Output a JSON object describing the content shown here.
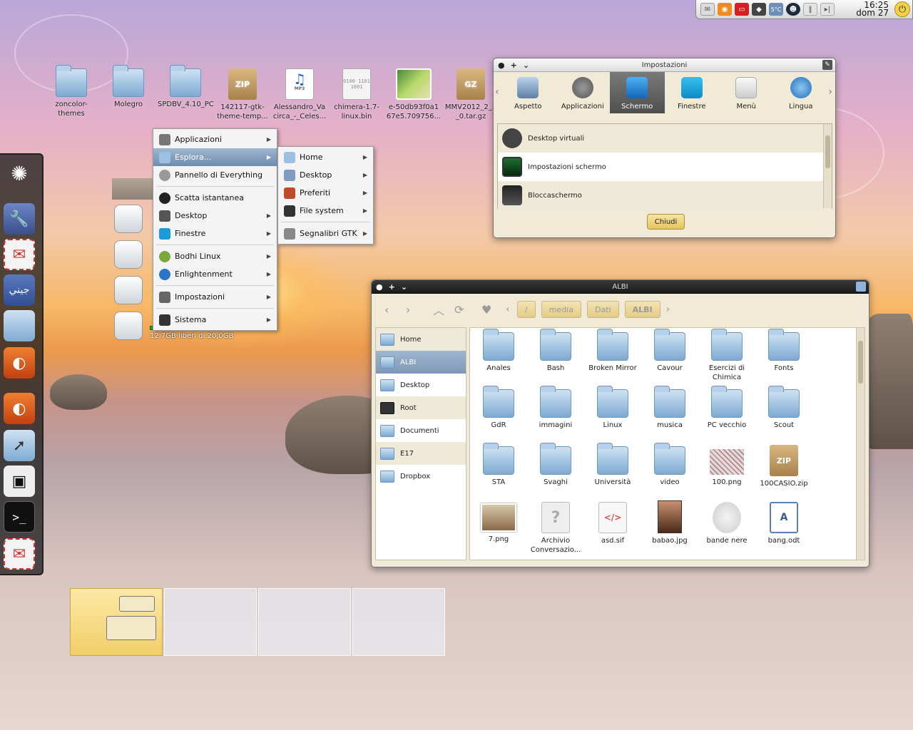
{
  "topbar": {
    "clock_time": "16:25",
    "clock_date": "dom 27",
    "weather": "5°C",
    "tray_icons": [
      "mail-icon",
      "rss-icon",
      "battery-icon",
      "dropbox-icon",
      "weather-icon",
      "alien-icon",
      "pause-icon",
      "next-icon",
      "power-icon"
    ]
  },
  "desktop_icons": [
    {
      "label": "zoncolor-themes",
      "type": "folder"
    },
    {
      "label": "Molegro",
      "type": "folder"
    },
    {
      "label": "SPDBV_4.10_PC",
      "type": "folder"
    },
    {
      "label": "142117-gtk-theme-temp...",
      "type": "zip",
      "badge": "ZIP"
    },
    {
      "label": "Alessandro_Va circa_-_Celes...",
      "type": "mp3",
      "badge": "MP3"
    },
    {
      "label": "chimera-1.7-linux.bin",
      "type": "bin",
      "badge": "0100 1101 1001"
    },
    {
      "label": "e-50db93f0a1 67e5.709756...",
      "type": "image"
    },
    {
      "label": "MMV2012_2_5 _0.tar.gz",
      "type": "gz",
      "badge": "GZ"
    }
  ],
  "dock": {
    "items": [
      "bodhi-logo-icon",
      "settings-icon",
      "mail-icon",
      "jini-icon",
      "folder-icon",
      "firefox-icon",
      "firefox-icon",
      "file-manager-icon",
      "computer-icon",
      "terminal-icon",
      "mail-icon"
    ],
    "jini_text": "جيني",
    "terminal_text": ">_"
  },
  "main_menu": {
    "items": [
      {
        "label": "Applicazioni",
        "icon": "gear-icon",
        "submenu": true
      },
      {
        "label": "Esplora...",
        "icon": "folder-icon",
        "submenu": true,
        "selected": true
      },
      {
        "label": "Pannello di Everything",
        "icon": "gear-icon",
        "submenu": false
      },
      {
        "label": "Scatta istantanea",
        "icon": "camera-icon",
        "submenu": false
      },
      {
        "label": "Desktop",
        "icon": "gear-icon",
        "submenu": true
      },
      {
        "label": "Finestre",
        "icon": "windows-icon",
        "submenu": true
      },
      {
        "label": "Bodhi Linux",
        "icon": "bodhi-icon",
        "submenu": true
      },
      {
        "label": "Enlightenment",
        "icon": "e-icon",
        "submenu": true
      },
      {
        "label": "Impostazioni",
        "icon": "wrench-icon",
        "submenu": true
      },
      {
        "label": "Sistema",
        "icon": "system-icon",
        "submenu": true
      }
    ]
  },
  "sub_menu": {
    "items": [
      {
        "label": "Home",
        "submenu": true
      },
      {
        "label": "Desktop",
        "submenu": true
      },
      {
        "label": "Preferiti",
        "submenu": true
      },
      {
        "label": "File system",
        "submenu": true
      },
      {
        "label": "Segnalibri GTK",
        "submenu": true
      }
    ]
  },
  "fs_panel": {
    "free_text": "12,7GB liberi di 20,0GB"
  },
  "settings_window": {
    "title": "Impostazioni",
    "tabs": [
      {
        "label": "Aspetto",
        "active": false
      },
      {
        "label": "Applicazioni",
        "active": false
      },
      {
        "label": "Schermo",
        "active": true
      },
      {
        "label": "Finestre",
        "active": false
      },
      {
        "label": "Menù",
        "active": false
      },
      {
        "label": "Lingua",
        "active": false
      }
    ],
    "list": [
      {
        "label": "Desktop virtuali"
      },
      {
        "label": "Impostazioni schermo"
      },
      {
        "label": "Bloccaschermo"
      }
    ],
    "close_label": "Chiudi"
  },
  "file_window": {
    "title": "ALBI",
    "path": [
      "/",
      "media",
      "Dati",
      "ALBI"
    ],
    "sidebar": [
      "Home",
      "ALBI",
      "Desktop",
      "Root",
      "Documenti",
      "E17",
      "Dropbox"
    ],
    "selected_sidebar": "ALBI",
    "files": [
      {
        "label": "Anales",
        "type": "folder"
      },
      {
        "label": "Bash",
        "type": "folder"
      },
      {
        "label": "Broken Mirror",
        "type": "folder"
      },
      {
        "label": "Cavour",
        "type": "folder"
      },
      {
        "label": "Esercizi di Chimica",
        "type": "folder"
      },
      {
        "label": "Fonts",
        "type": "folder"
      },
      {
        "label": "GdR",
        "type": "folder"
      },
      {
        "label": "immagini",
        "type": "folder"
      },
      {
        "label": "Linux",
        "type": "folder"
      },
      {
        "label": "musica",
        "type": "folder"
      },
      {
        "label": "PC vecchio",
        "type": "folder"
      },
      {
        "label": "Scout",
        "type": "folder"
      },
      {
        "label": "STA",
        "type": "folder"
      },
      {
        "label": "Svaghi",
        "type": "folder"
      },
      {
        "label": "Università",
        "type": "folder"
      },
      {
        "label": "video",
        "type": "folder"
      },
      {
        "label": "100.png",
        "type": "png"
      },
      {
        "label": "100CASIO.zip",
        "type": "zip"
      },
      {
        "label": "7.png",
        "type": "png"
      },
      {
        "label": "Archivio Conversazio...",
        "type": "unknown"
      },
      {
        "label": "asd.sif",
        "type": "code"
      },
      {
        "label": "babao.jpg",
        "type": "jpg"
      },
      {
        "label": "bande nere",
        "type": "gear"
      },
      {
        "label": "bang.odt",
        "type": "odt"
      }
    ]
  },
  "pager": {
    "desks": 4,
    "active": 0
  }
}
